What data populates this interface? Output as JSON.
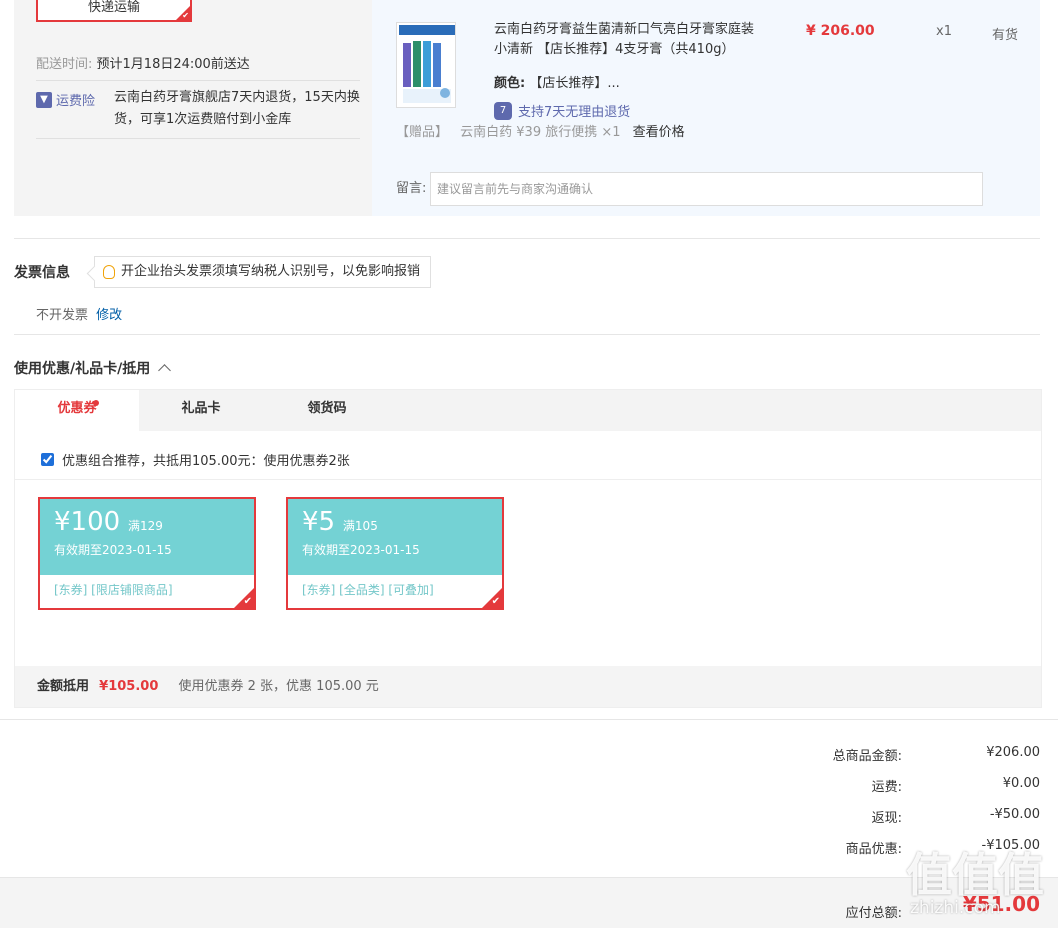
{
  "shipping": {
    "method_button": "快递运输",
    "time_label": "配送时间:",
    "time_value": "预计1月18日24:00前送达",
    "insurance_label": "运费险",
    "insurance_icon": "shield-icon",
    "insurance_text": "云南白药牙膏旗舰店7天内退货，15天内换货，可享1次运费赔付到小金库"
  },
  "goods": {
    "title": "云南白药牙膏益生菌清新口气亮白牙膏家庭装小清新 【店长推荐】4支牙膏（共410g）",
    "color_label": "颜色:",
    "color_value": "【店长推荐】...",
    "return_policy": "支持7天无理由退货",
    "return_icon_text": "7",
    "price": "¥ 206.00",
    "quantity": "x1",
    "stock": "有货",
    "gift_prefix": "【赠品】",
    "gift_text": "云南白药 ¥39 旅行便携 ×1",
    "gift_link": "查看价格",
    "message_label": "留言:",
    "message_placeholder": "建议留言前先与商家沟通确认"
  },
  "invoice": {
    "title": "发票信息",
    "tip": "开企业抬头发票须填写纳税人识别号，以免影响报销",
    "status": "不开发票",
    "edit_link": "修改"
  },
  "coupons": {
    "title": "使用优惠/礼品卡/抵用",
    "tabs": [
      {
        "label": "优惠券"
      },
      {
        "label": "礼品卡"
      },
      {
        "label": "领货码"
      }
    ],
    "combo_text": "优惠组合推荐，共抵用105.00元：使用优惠券2张",
    "items": [
      {
        "amount": "¥100",
        "condition": "满129",
        "expiry": "有效期至2023-01-15",
        "tags": "[东券]  [限店铺限商品]"
      },
      {
        "amount": "¥5",
        "condition": "满105",
        "expiry": "有效期至2023-01-15",
        "tags": "[东券]  [全品类]  [可叠加]"
      }
    ],
    "summary_label": "金额抵用",
    "summary_amount": "¥105.00",
    "summary_text": "使用优惠券 2 张，优惠 105.00 元",
    "colors": {
      "accent": "#e4393c",
      "coupon_bg": "#74d2d4"
    }
  },
  "totals": {
    "rows": [
      {
        "label": "总商品金额:",
        "value": "¥206.00"
      },
      {
        "label": "运费:",
        "value": "¥0.00"
      },
      {
        "label": "返现:",
        "value": "-¥50.00"
      },
      {
        "label": "商品优惠:",
        "value": "-¥105.00"
      }
    ],
    "pay_label": "应付总额:",
    "pay_value": "¥51.00"
  },
  "watermark": {
    "glyphs": [
      "值",
      "值",
      "值"
    ],
    "url": "zhizhi.com"
  }
}
